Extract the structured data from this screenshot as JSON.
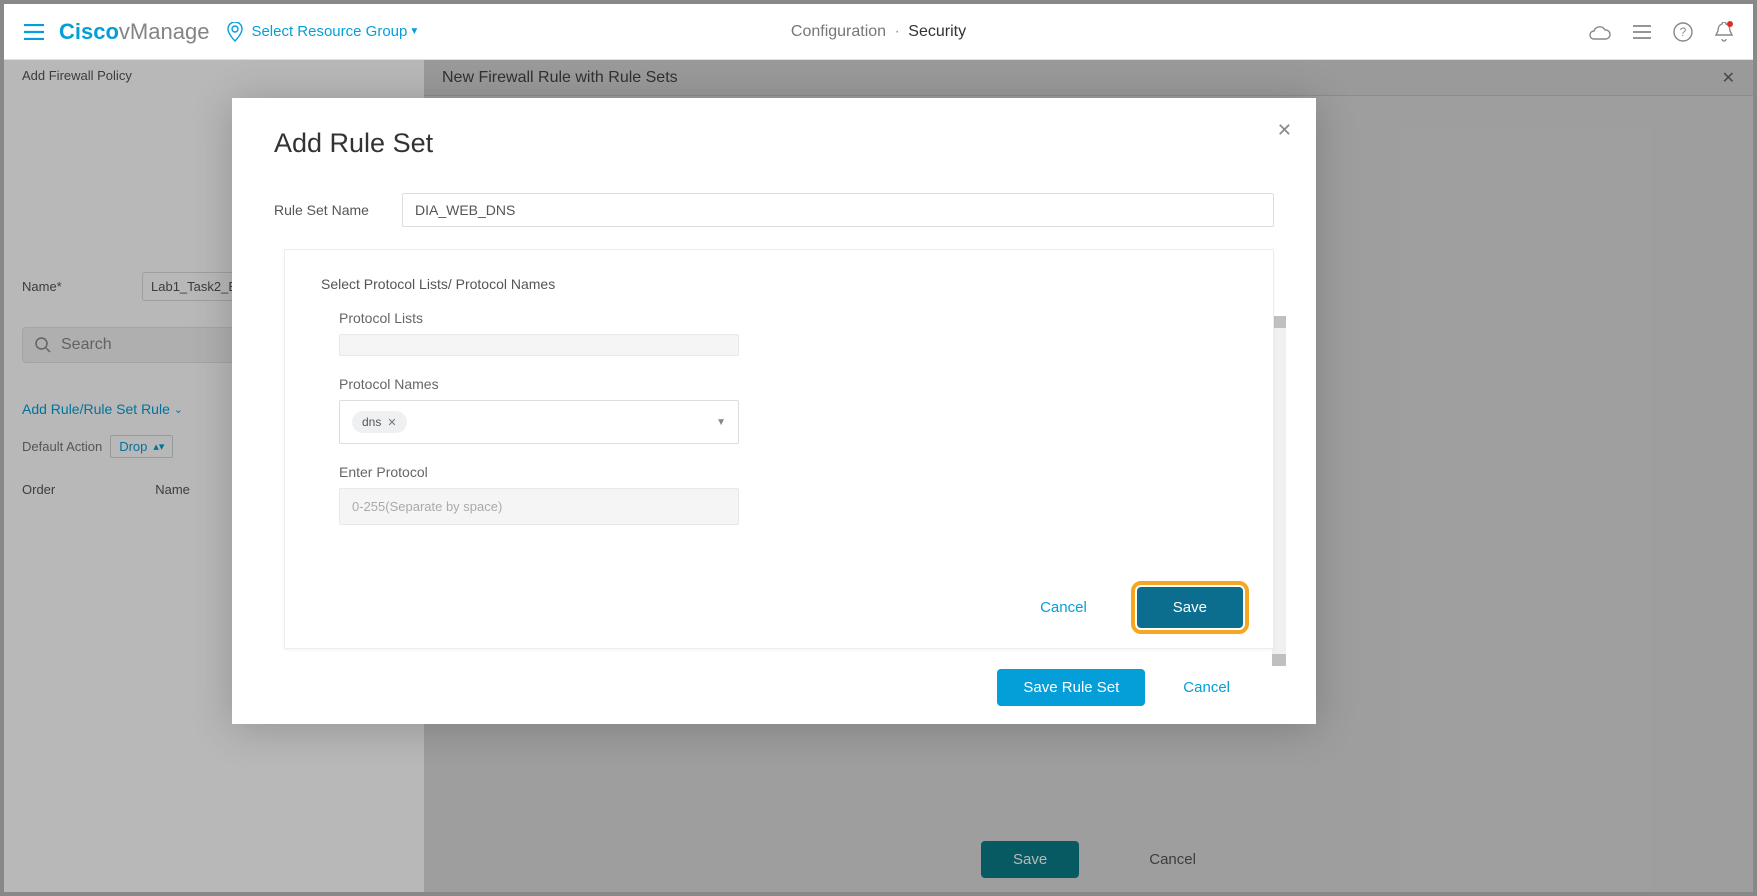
{
  "topbar": {
    "brand_bold": "Cisco",
    "brand_light": " vManage",
    "resource_group": "Select Resource Group",
    "breadcrumb_a": "Configuration",
    "breadcrumb_sep": "·",
    "breadcrumb_b": "Security"
  },
  "background": {
    "left_title": "Add Firewall Policy",
    "name_label": "Name*",
    "name_value": "Lab1_Task2_Bran",
    "search_placeholder": "Search",
    "add_rule_link": "Add Rule/Rule Set Rule",
    "default_action_label": "Default Action",
    "default_action_value": "Drop",
    "col_order": "Order",
    "col_name": "Name",
    "right_title": "New Firewall Rule with Rule Sets",
    "save": "Save",
    "cancel": "Cancel"
  },
  "modal": {
    "title": "Add Rule Set",
    "rule_set_name_label": "Rule Set Name",
    "rule_set_name_value": "DIA_WEB_DNS",
    "inner_title": "Select Protocol Lists/ Protocol Names",
    "protocol_lists_label": "Protocol Lists",
    "protocol_names_label": "Protocol Names",
    "protocol_chip": "dns",
    "enter_protocol_label": "Enter Protocol",
    "enter_protocol_placeholder": "0-255(Separate by space)",
    "inner_cancel": "Cancel",
    "inner_save": "Save",
    "footer_save": "Save Rule Set",
    "footer_cancel": "Cancel"
  }
}
